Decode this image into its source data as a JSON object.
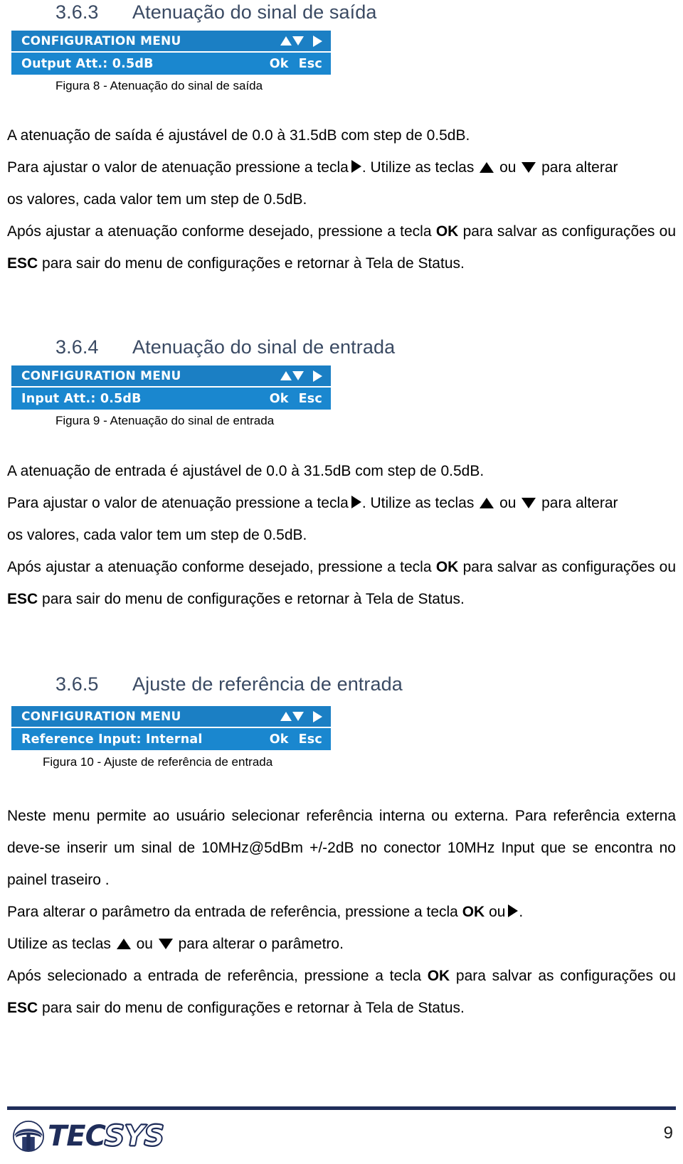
{
  "document": {
    "page_number": "9",
    "footer_brand": {
      "part1": "TEC",
      "part2": "SYS"
    }
  },
  "sections": [
    {
      "number": "3.6.3",
      "title": "Atenuação do sinal de saída",
      "lcd": {
        "title": "CONFIGURATION MENU",
        "value_line": "Output Att.: 0.5dB",
        "ok_label": "Ok",
        "esc_label": "Esc",
        "key_icons": [
          "triangle-up-icon",
          "triangle-down-icon",
          "triangle-right-icon"
        ]
      },
      "caption": "Figura 8 - Atenuação do sinal de saída",
      "paragraphs": {
        "p1": "A atenuação de saída é ajustável de 0.0 à 31.5dB com step de 0.5dB.",
        "p2_a": "Para ajustar o valor de atenuação pressione a tecla",
        "p2_b": ". Utilize as teclas",
        "p2_c": "ou",
        "p2_d": "para alterar",
        "p3": "os valores, cada valor tem um step de 0.5dB.",
        "p4_a": "Após ajustar a atenuação conforme desejado, pressione a tecla",
        "p4_ok": "OK",
        "p4_b": "para salvar as configurações ou",
        "p4_esc": "ESC",
        "p4_c": "para sair do menu de configurações e retornar à Tela de Status."
      }
    },
    {
      "number": "3.6.4",
      "title": "Atenuação do sinal de entrada",
      "lcd": {
        "title": "CONFIGURATION MENU",
        "value_line": "Input Att.: 0.5dB",
        "ok_label": "Ok",
        "esc_label": "Esc",
        "key_icons": [
          "triangle-up-icon",
          "triangle-down-icon",
          "triangle-right-icon"
        ]
      },
      "caption": "Figura 9 - Atenuação do sinal de entrada",
      "paragraphs": {
        "p1": "A atenuação de entrada é ajustável de 0.0 à 31.5dB com step de 0.5dB.",
        "p2_a": "Para ajustar o valor de atenuação pressione a tecla",
        "p2_b": ". Utilize as teclas",
        "p2_c": "ou",
        "p2_d": "para alterar",
        "p3": "os valores, cada valor tem um step de 0.5dB.",
        "p4_a": "Após ajustar a atenuação conforme desejado, pressione a tecla",
        "p4_ok": "OK",
        "p4_b": "para salvar as configurações ou",
        "p4_esc": "ESC",
        "p4_c": "para sair do menu de configurações e retornar à Tela de Status."
      }
    },
    {
      "number": "3.6.5",
      "title": "Ajuste de referência de entrada",
      "lcd": {
        "title": "CONFIGURATION MENU",
        "value_line": "Reference Input: Internal",
        "ok_label": "Ok",
        "esc_label": "Esc",
        "key_icons": [
          "triangle-up-icon",
          "triangle-down-icon",
          "triangle-right-icon"
        ]
      },
      "caption": "Figura 10 - Ajuste de referência de entrada",
      "paragraphs": {
        "p1": "Neste menu permite ao usuário selecionar referência interna ou externa. Para referência externa deve-se inserir um sinal de 10MHz@5dBm +/-2dB no conector 10MHz Input que se encontra no painel traseiro .",
        "p2_a": "Para alterar o parâmetro da entrada de referência, pressione a tecla",
        "p2_ok": "OK",
        "p2_b": "ou",
        "p2_c": ".",
        "p3_a": "Utilize as teclas",
        "p3_b": "ou",
        "p3_c": "para alterar o parâmetro.",
        "p4_a": "Após selecionado a entrada de referência, pressione a tecla",
        "p4_ok": "OK",
        "p4_b": "para salvar as configurações ou",
        "p4_esc": "ESC",
        "p4_c": "para sair do menu de configurações e retornar à Tela de Status."
      }
    }
  ]
}
